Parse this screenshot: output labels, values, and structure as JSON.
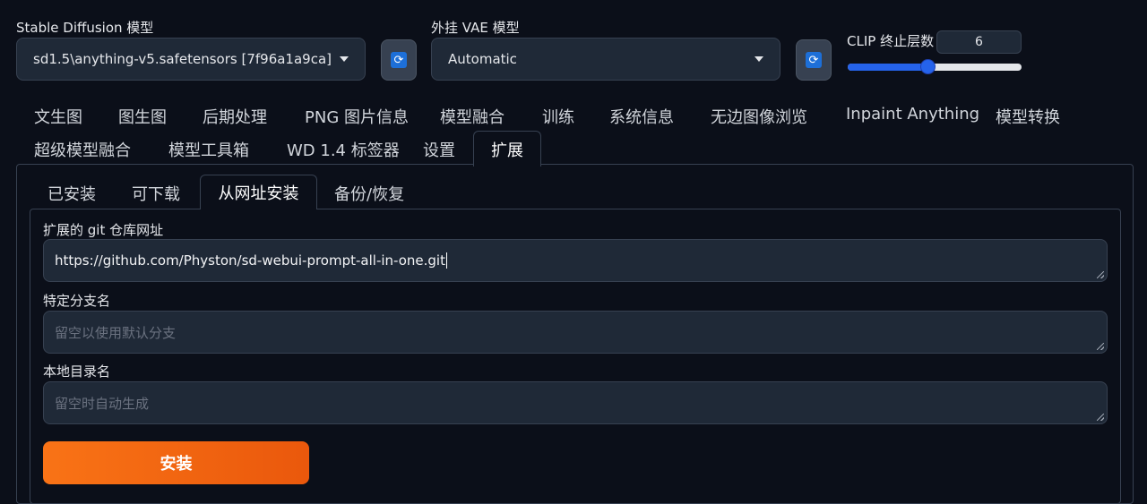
{
  "header": {
    "sd_model": {
      "label": "Stable Diffusion 模型",
      "value": "sd1.5\\anything-v5.safetensors [7f96a1a9ca]"
    },
    "vae": {
      "label": "外挂 VAE 模型",
      "value": "Automatic"
    },
    "clip": {
      "label": "CLIP 终止层数",
      "value": "6",
      "slider_fraction": 0.46
    }
  },
  "main_tabs": {
    "row1": [
      "文生图",
      "图生图",
      "后期处理",
      "PNG 图片信息",
      "模型融合",
      "训练",
      "系统信息",
      "无边图像浏览",
      "Inpaint Anything",
      "模型转换"
    ],
    "row2": [
      "超级模型融合",
      "模型工具箱",
      "WD 1.4 标签器",
      "设置",
      "扩展"
    ],
    "active": "扩展"
  },
  "sub_tabs": {
    "items": [
      "已安装",
      "可下载",
      "从网址安装",
      "备份/恢复"
    ],
    "active": "从网址安装"
  },
  "form": {
    "git_url": {
      "label": "扩展的 git 仓库网址",
      "value": "https://github.com/Physton/sd-webui-prompt-all-in-one.git"
    },
    "branch": {
      "label": "特定分支名",
      "placeholder": "留空以使用默认分支"
    },
    "local_dir": {
      "label": "本地目录名",
      "placeholder": "留空时自动生成"
    },
    "install_label": "安装"
  },
  "colors": {
    "accent": "#f97316",
    "slider": "#2563eb",
    "background": "#0b0f19",
    "input_bg": "#1f2937"
  }
}
